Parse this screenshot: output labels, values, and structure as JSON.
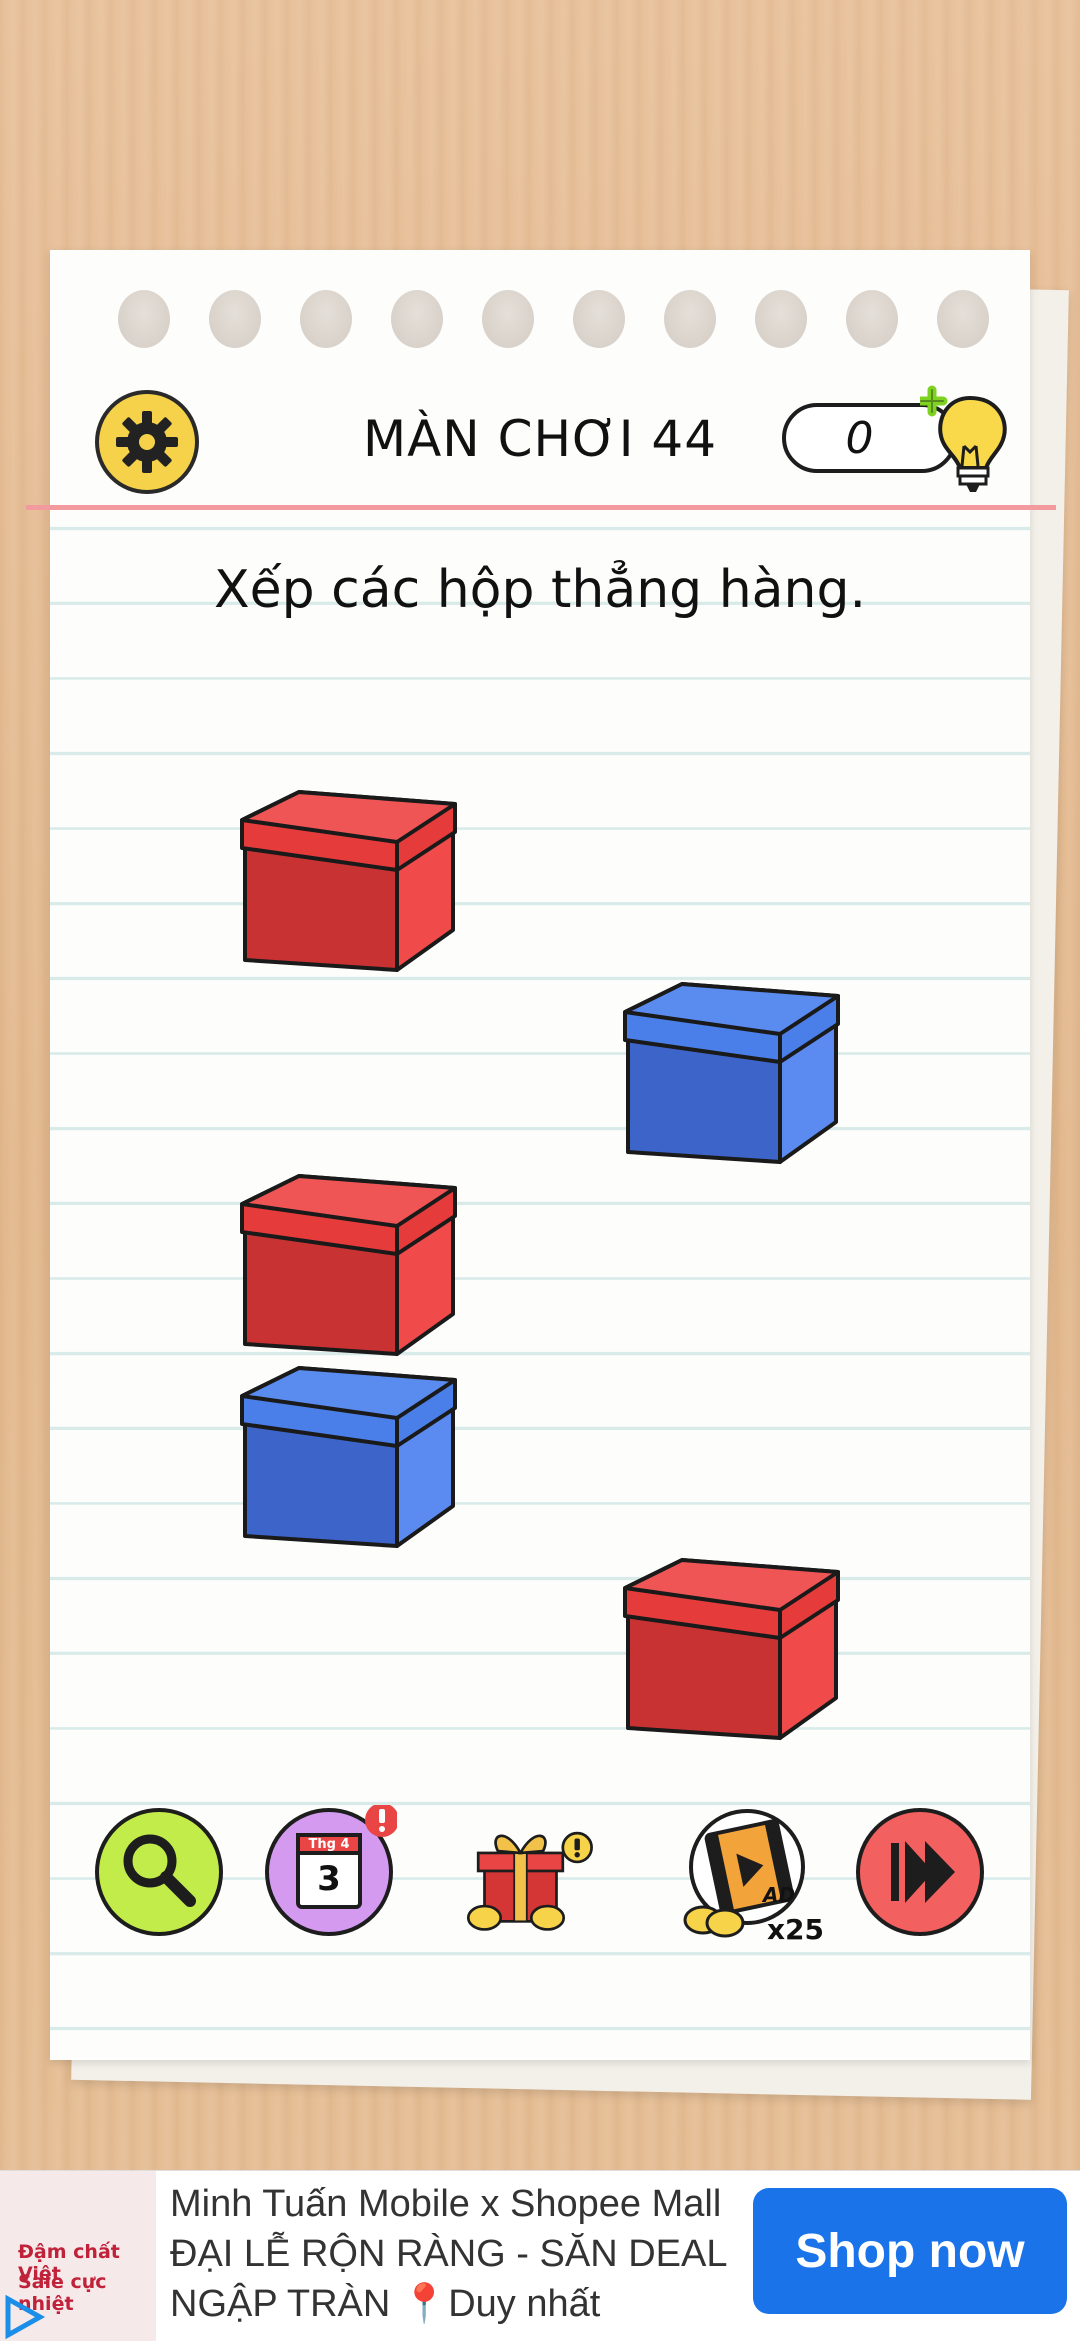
{
  "header": {
    "level_title": "MÀN CHƠI 44",
    "hint_count": "0"
  },
  "puzzle": {
    "instruction": "Xếp các hộp thẳng hàng."
  },
  "boxes": [
    {
      "color": "red"
    },
    {
      "color": "blue"
    },
    {
      "color": "red"
    },
    {
      "color": "blue"
    },
    {
      "color": "red"
    }
  ],
  "toolbar": {
    "calendar_month": "Thg 4",
    "calendar_day": "3",
    "video_reward": "x25",
    "ad_badge": "AD"
  },
  "ad": {
    "text": "Minh Tuấn Mobile x Shopee Mall ĐẠI LỄ RỘN RÀNG - SĂN DEAL NGẬP TRÀN 📍Duy nhất",
    "button_label": "Shop now",
    "logo_line1": "Đậm chất Việt",
    "logo_line2": "Sale cực nhiệt"
  },
  "colors": {
    "red_box": "#e63b3b",
    "blue_box": "#4a7ee8",
    "accent_yellow": "#f5d24a",
    "shop_button": "#1a73e8"
  }
}
